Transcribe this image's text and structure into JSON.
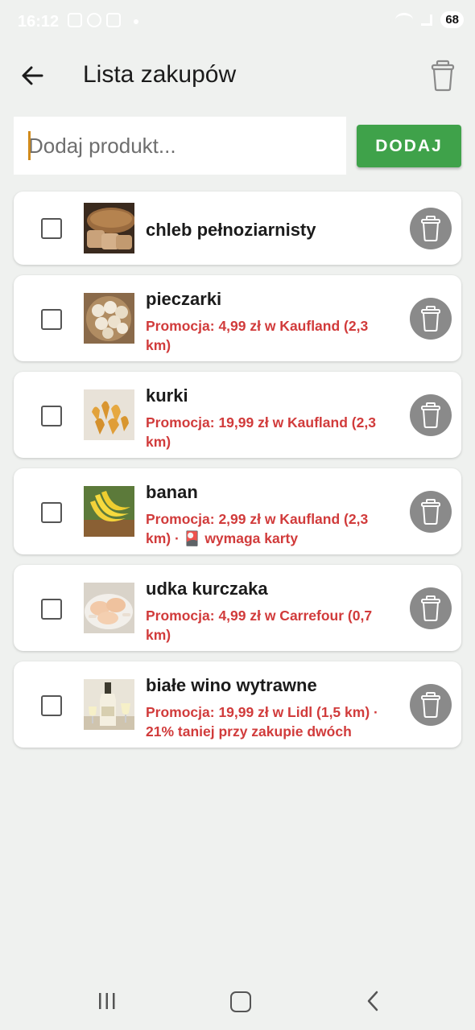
{
  "status_bar": {
    "time": "16:12",
    "battery": "68"
  },
  "app_bar": {
    "title": "Lista zakupów"
  },
  "add_form": {
    "placeholder": "Dodaj produkt...",
    "button_label": "DODAJ"
  },
  "colors": {
    "accent": "#3fa24a",
    "promo": "#d13b3b",
    "caret": "#d18b1c",
    "background": "#eff1ef"
  },
  "items": [
    {
      "name": "chleb pełnoziarnisty",
      "promo": "",
      "checked": false,
      "image": "bread"
    },
    {
      "name": "pieczarki",
      "promo": "Promocja: 4,99 zł w Kaufland (2,3 km)",
      "checked": false,
      "image": "mushrooms"
    },
    {
      "name": "kurki",
      "promo": "Promocja: 19,99 zł w Kaufland (2,3 km)",
      "checked": false,
      "image": "chanterelles"
    },
    {
      "name": "banan",
      "promo": "Promocja: 2,99 zł w Kaufland (2,3 km) · 🎴 wymaga karty",
      "checked": false,
      "image": "bananas"
    },
    {
      "name": "udka kurczaka",
      "promo": "Promocja: 4,99 zł w Carrefour (0,7 km)",
      "checked": false,
      "image": "chicken"
    },
    {
      "name": "białe wino wytrawne",
      "promo": "Promocja: 19,99 zł w Lidl (1,5 km) · 21% taniej przy zakupie dwóch",
      "checked": false,
      "image": "wine"
    }
  ]
}
